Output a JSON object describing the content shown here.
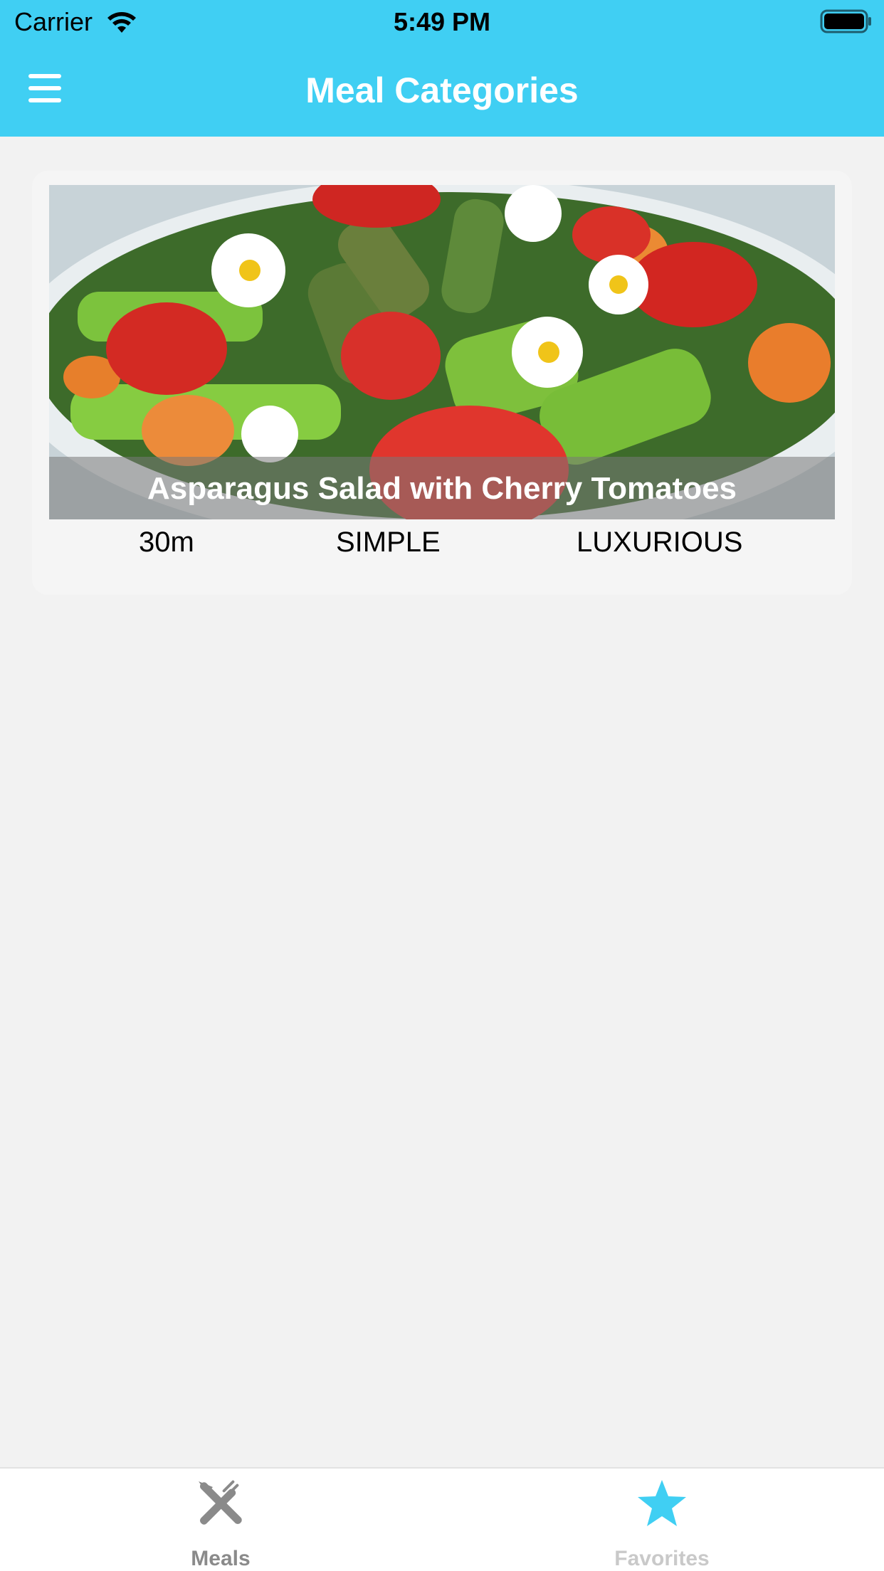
{
  "status_bar": {
    "carrier": "Carrier",
    "time": "5:49 PM"
  },
  "nav": {
    "title": "Meal Categories",
    "menu_icon": "hamburger-menu-icon"
  },
  "meal": {
    "title": "Asparagus Salad with Cherry Tomatoes",
    "duration": "30m",
    "complexity": "SIMPLE",
    "affordability": "LUXURIOUS"
  },
  "tabs": [
    {
      "label": "Meals",
      "icon": "fork-knife-icon",
      "color": "#8a8a8a"
    },
    {
      "label": "Favorites",
      "icon": "star-icon",
      "color": "#c9c9c9",
      "icon_color": "#40cff3"
    }
  ],
  "colors": {
    "accent": "#40cff3",
    "background": "#f2f2f2"
  }
}
